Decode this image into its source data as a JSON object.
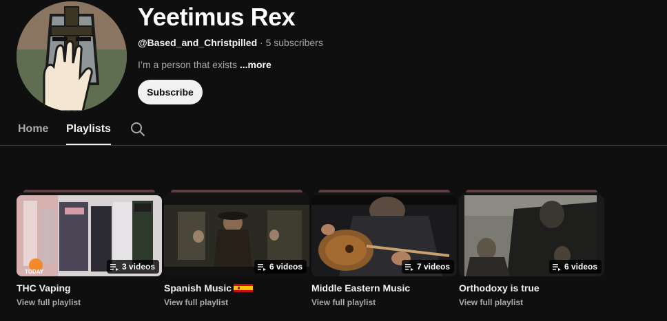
{
  "channel": {
    "name": "Yeetimus Rex",
    "handle": "@Based_and_Christpilled",
    "separator": " · ",
    "subscribers": "5 subscribers",
    "description": "I’m a person that exists ",
    "more_label": "...more",
    "subscribe_label": "Subscribe",
    "avatar_icon": "crusader-knight-avatar"
  },
  "tabs": [
    {
      "label": "Home",
      "active": false
    },
    {
      "label": "Playlists",
      "active": true
    }
  ],
  "search_icon": "search-icon",
  "playlists": [
    {
      "title": "THC Vaping",
      "count": "3 videos",
      "link": "View full playlist",
      "thumb_label": "TODAY",
      "has_flag": false
    },
    {
      "title": "Spanish Music",
      "count": "6 videos",
      "link": "View full playlist",
      "has_flag": true,
      "flag_icon": "spain-flag-icon"
    },
    {
      "title": "Middle Eastern Music",
      "count": "7 videos",
      "link": "View full playlist",
      "has_flag": false
    },
    {
      "title": "Orthodoxy is true",
      "count": "6 videos",
      "link": "View full playlist",
      "has_flag": false
    }
  ],
  "colors": {
    "background": "#0f0f0f",
    "text_primary": "#f1f1f1",
    "text_secondary": "#aaaaaa",
    "subscribe_bg": "#f1f1f1",
    "divider": "#3f3f3f"
  }
}
